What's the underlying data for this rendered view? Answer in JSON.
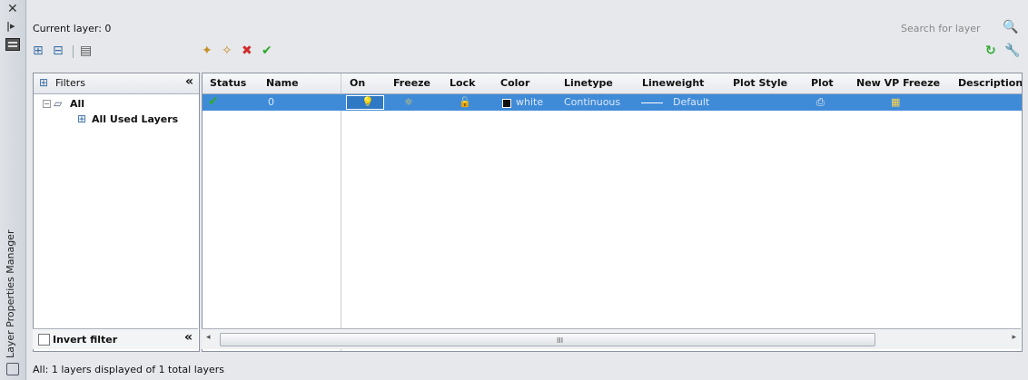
{
  "palette": {
    "title": "Layer Properties Manager"
  },
  "header": {
    "current_layer": "Current layer: 0",
    "search_placeholder": "Search for layer"
  },
  "filters": {
    "title": "Filters",
    "tree_root": "All",
    "tree_child": "All Used Layers",
    "invert_label": "Invert filter"
  },
  "grid": {
    "columns": [
      "Status",
      "Name",
      "On",
      "Freeze",
      "Lock",
      "Color",
      "Linetype",
      "Lineweight",
      "Plot Style",
      "Plot",
      "New VP Freeze",
      "Description"
    ],
    "rows": [
      {
        "name": "0",
        "color": "white",
        "linetype": "Continuous",
        "lineweight": "Default"
      }
    ]
  },
  "scrollbar": {
    "grip": "III"
  },
  "status": {
    "text": "All: 1 layers displayed of 1 total layers"
  },
  "icons": {
    "close": "close-icon",
    "autohide": "autohide-icon",
    "properties": "properties-icon",
    "new_filter": "new-property-filter-icon",
    "group_filter": "new-group-filter-icon",
    "states": "layer-states-manager-icon",
    "new_layer": "new-layer-icon",
    "new_vp_layer": "new-layer-vp-frozen-icon",
    "delete": "delete-layer-icon",
    "set_current": "set-current-icon",
    "refresh": "refresh-icon",
    "settings": "settings-icon",
    "search": "search-icon"
  },
  "colors": {
    "selection": "#3f8bd8",
    "check": "#2eaa2e",
    "delete": "#d12b2b"
  }
}
